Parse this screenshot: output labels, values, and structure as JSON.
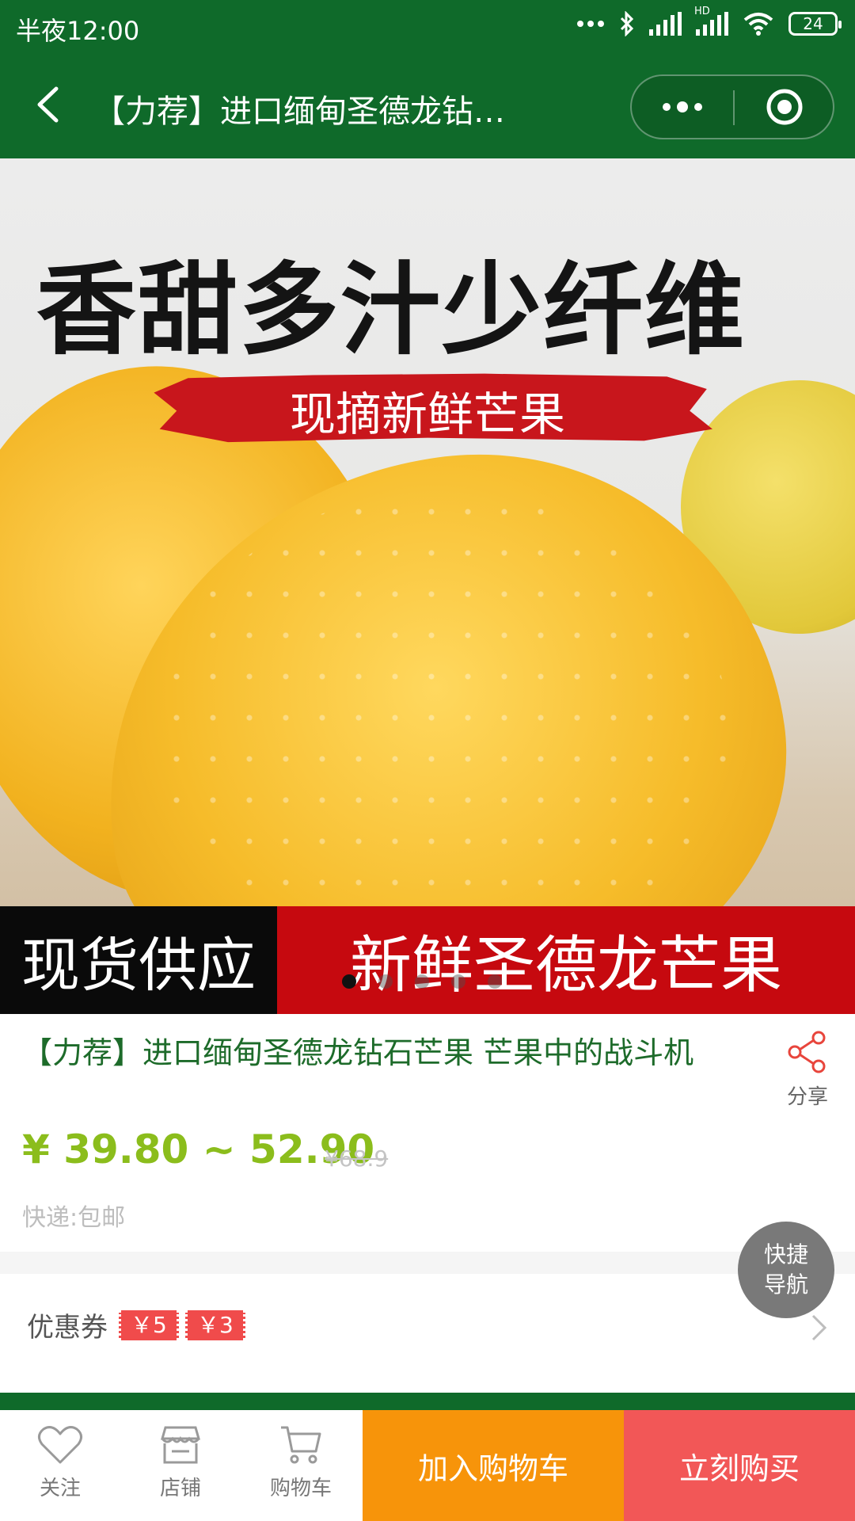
{
  "status": {
    "time": "半夜12:00",
    "battery": "24",
    "hd_label": "HD"
  },
  "header": {
    "title": "【力荐】进口缅甸圣德龙钻…"
  },
  "hero": {
    "headline": "香甜多汁少纤维",
    "subheadline": "现摘新鲜芒果",
    "banner_left": "现货供应",
    "banner_right": "新鲜圣德龙芒果",
    "slide_count": 5,
    "active_slide": 1
  },
  "product": {
    "title": "【力荐】进口缅甸圣德龙钻石芒果 芒果中的战斗机",
    "share_label": "分享",
    "price": "¥ 39.80 ~ 52.90",
    "original_price": "¥68.9",
    "shipping": "快递:包邮"
  },
  "coupons": {
    "label": "优惠券",
    "items": [
      "￥5",
      "￥3"
    ]
  },
  "fab": {
    "line1": "快捷",
    "line2": "导航"
  },
  "bottom_nav": {
    "follow": "关注",
    "shop": "店铺",
    "cart": "购物车",
    "add_to_cart": "加入购物车",
    "buy_now": "立刻购买"
  },
  "colors": {
    "brand_green": "#0f6a2a",
    "price_green": "#8bbd1c",
    "cart_orange": "#f7940a",
    "buy_red": "#f25757",
    "coupon_red": "#f04b4b"
  }
}
